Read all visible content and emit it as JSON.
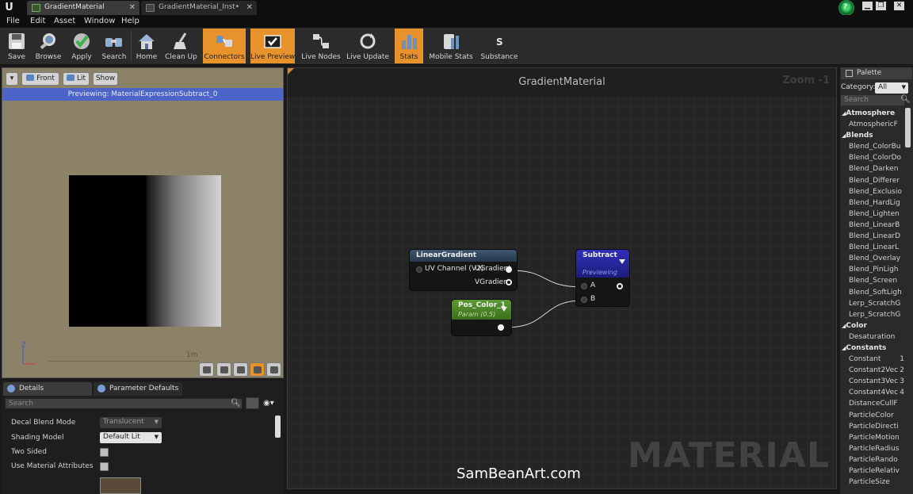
{
  "titlebar": {
    "logo": "U",
    "tabs": [
      {
        "label": "GradientMaterial",
        "active": true
      },
      {
        "label": "GradientMaterial_Inst•",
        "active": false
      }
    ],
    "help": "?",
    "window_buttons": [
      "▁",
      "❐",
      "✕"
    ]
  },
  "menu": [
    "File",
    "Edit",
    "Asset",
    "Window",
    "Help"
  ],
  "toolbar": [
    {
      "label": "Save",
      "icon": "save-icon",
      "active": false
    },
    {
      "label": "Browse",
      "icon": "browse-icon",
      "active": false
    },
    {
      "label": "Apply",
      "icon": "apply-icon",
      "active": false
    },
    {
      "label": "Search",
      "icon": "search-icon",
      "active": false
    },
    {
      "label": "Home",
      "icon": "home-icon",
      "active": false
    },
    {
      "label": "Clean Up",
      "icon": "clean-up-icon",
      "active": false
    },
    {
      "label": "Connectors",
      "icon": "connectors-icon",
      "active": true
    },
    {
      "label": "Live Preview",
      "icon": "live-preview-icon",
      "active": true
    },
    {
      "label": "Live Nodes",
      "icon": "live-nodes-icon",
      "active": false
    },
    {
      "label": "Live Update",
      "icon": "live-update-icon",
      "active": false
    },
    {
      "label": "Stats",
      "icon": "stats-icon",
      "active": true
    },
    {
      "label": "Mobile Stats",
      "icon": "mobile-stats-icon",
      "active": false
    },
    {
      "label": "Substance",
      "icon": "substance-icon",
      "active": false
    }
  ],
  "viewport": {
    "view_mode": "Front",
    "lighting": "Lit",
    "show": "Show",
    "previewing": "Previewing: MaterialExpressionSubtract_0",
    "axis_z": "Z",
    "scale": "1m"
  },
  "details": {
    "tabs": [
      "Details",
      "Parameter Defaults"
    ],
    "search_placeholder": "Search",
    "rows": [
      {
        "label": "Decal Blend Mode",
        "type": "combo",
        "value": "Translucent"
      },
      {
        "label": "Shading Model",
        "type": "combo",
        "value": "Default Lit"
      },
      {
        "label": "Two Sided",
        "type": "check",
        "value": false
      },
      {
        "label": "Use Material Attributes",
        "type": "check",
        "value": false
      }
    ]
  },
  "graph": {
    "title": "GradientMaterial",
    "zoom": "Zoom -1",
    "watermark": "MATERIAL",
    "nodes": {
      "linear_gradient": {
        "title": "LinearGradient",
        "input": "UV Channel (V2)",
        "outputs": [
          "UGradient",
          "VGradient"
        ]
      },
      "subtract": {
        "title": "Subtract",
        "subtitle": "Previewing",
        "inputs": [
          "A",
          "B"
        ]
      },
      "pos_color": {
        "title": "Pos_Color_1",
        "subtitle": "Param (0.5)"
      }
    }
  },
  "palette": {
    "tab": "Palette",
    "category_label": "Category:",
    "category_value": "All",
    "search_placeholder": "Search",
    "groups": [
      {
        "name": "Atmosphere",
        "items": [
          "AtmosphericF"
        ]
      },
      {
        "name": "Blends",
        "items": [
          "Blend_ColorBu",
          "Blend_ColorDo",
          "Blend_Darken",
          "Blend_Differer",
          "Blend_Exclusio",
          "Blend_HardLig",
          "Blend_Lighten",
          "Blend_LinearB",
          "Blend_LinearD",
          "Blend_LinearL",
          "Blend_Overlay",
          "Blend_PinLigh",
          "Blend_Screen",
          "Blend_SoftLigh",
          "Lerp_ScratchG",
          "Lerp_ScratchG"
        ]
      },
      {
        "name": "Color",
        "items": [
          "Desaturation"
        ]
      },
      {
        "name": "Constants",
        "items": [
          "Constant",
          "Constant2Vec",
          "Constant3Vec",
          "Constant4Vec",
          "DistanceCullF",
          "ParticleColor",
          "ParticleDirecti",
          "ParticleMotion",
          "ParticleRadius",
          "ParticleRando",
          "ParticleRelativ",
          "ParticleSize"
        ]
      }
    ],
    "constant_suffixes": {
      "Constant": "1",
      "Constant2Vec": "2",
      "Constant3Vec": "3",
      "Constant4Vec": "4"
    }
  },
  "site_watermark": "SamBeanArt.com",
  "colors": {
    "accent_active": "#e8922c",
    "preview_banner": "#4c63c7",
    "subtract_header": "#2a2a9e",
    "param_header": "#4f8a2a",
    "gradient_header": "#2e4057"
  }
}
